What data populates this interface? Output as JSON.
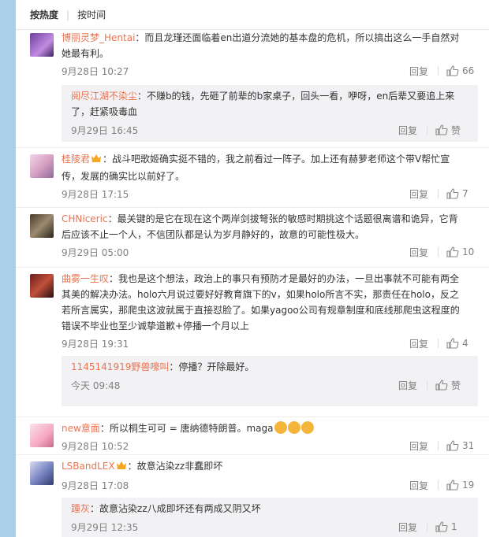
{
  "sort": {
    "hot": "按热度",
    "time": "按时间"
  },
  "actions": {
    "reply": "回复",
    "zan": "赞"
  },
  "comments": [
    {
      "user": "博丽灵梦_Hentai",
      "text": "：而且龙瑾还面临着en出道分流她的基本盘的危机，所以搞出这么一手自然对她最有利。",
      "time": "9月28日 10:27",
      "likes": "66",
      "reply": {
        "user": "阅尽江湖不染尘",
        "text": "：不赚b的钱，先砸了前辈的b家桌子，回头一看，咿呀，en后辈又要追上来了，赶紧吸毒血",
        "time": "9月29日 16:45"
      }
    },
    {
      "user": "桂陵君",
      "text": "：战斗吧歌姬确实挺不错的，我之前看过一阵子。加上还有赫萝老师这个带V帮忙宣传，发展的确实比以前好了。",
      "time": "9月28日 17:15",
      "likes": "7"
    },
    {
      "user": "CHNiceric",
      "text": "：最关键的是它在现在这个两岸剑拔弩张的敏感时期挑这个话题很离谱和诡异，它背后应该不止一个人，不信团队都是认为岁月静好的，故意的可能性极大。",
      "time": "9月29日 05:00",
      "likes": "10"
    },
    {
      "user": "曲雾一生叹",
      "text": "：我也是这个想法，政治上的事只有预防才是最好的办法，一旦出事就不可能有两全其美的解决办法。holo六月说过要好好教育旗下的v，如果holo所言不实，那责任在holo，反之若所言属实，那爬虫这波就属于直接怼脸了。如果yagoo公司有规章制度和底线那爬虫这程度的错误不毕业也至少诚挚道歉+停播一个月以上",
      "time": "9月28日 19:31",
      "likes": "4",
      "reply": {
        "user": "1145141919野兽嚎叫",
        "text": "：停播？开除最好。",
        "time": "今天 09:48"
      }
    },
    {
      "user": "new意面",
      "text": "：所以桐生可可 = 唐纳德特朗普。maga",
      "time": "9月28日 10:52",
      "likes": "31"
    },
    {
      "user": "LSBandLEX",
      "text": "：故意沾染zz非蠢即坏",
      "time": "9月28日 17:08",
      "likes": "19",
      "reply": {
        "user": "踵灰",
        "text": "：故意沾染zz八成即坏还有两成又阴又坏",
        "time": "9月29日 12:35",
        "likes": "1"
      }
    }
  ]
}
